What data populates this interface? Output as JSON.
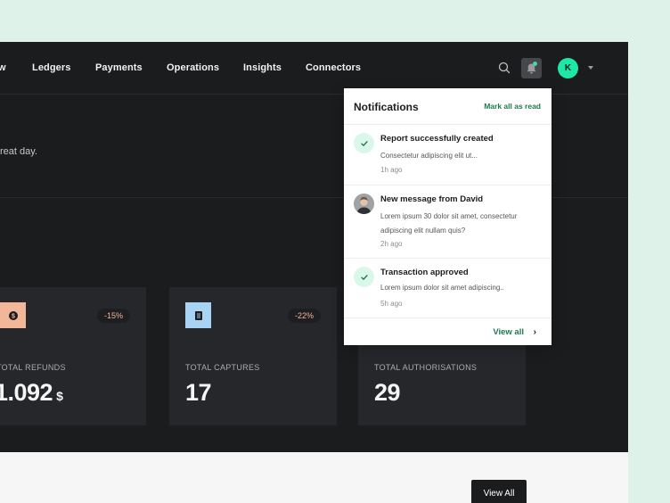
{
  "nav": {
    "items": [
      {
        "label": "w"
      },
      {
        "label": "Ledgers"
      },
      {
        "label": "Payments"
      },
      {
        "label": "Operations"
      },
      {
        "label": "Insights"
      },
      {
        "label": "Connectors"
      }
    ],
    "avatar_initial": "K",
    "icons": {
      "search": "search-icon",
      "bell": "bell-icon",
      "caret": "chevron-down-icon"
    }
  },
  "greeting": "reat day.",
  "cards": [
    {
      "icon": "dollar-icon",
      "icon_color": "#f2b699",
      "pct": "-15%",
      "label": "TOTAL REFUNDS",
      "value": "1.092",
      "unit": "$"
    },
    {
      "icon": "document-icon",
      "icon_color": "#a9d3f5",
      "pct": "-22%",
      "label": "TOTAL CAPTURES",
      "value": "17",
      "unit": ""
    },
    {
      "label": "TOTAL AUTHORISATIONS",
      "value": "29",
      "unit": ""
    }
  ],
  "notifications": {
    "title": "Notifications",
    "mark_all": "Mark all as read",
    "items": [
      {
        "icon": "check-icon",
        "title": "Report successfully created",
        "body": "Consectetur adipiscing elit ut...",
        "time": "1h ago"
      },
      {
        "icon": "avatar-photo",
        "title": "New message from David",
        "body": "Lorem ipsum 30 dolor sit amet, consectetur adipiscing elit nullam quis?",
        "time": "2h ago"
      },
      {
        "icon": "check-icon",
        "title": "Transaction approved",
        "body": "Lorem ipsum dolor sit amet adipiscing..",
        "time": "5h ago"
      }
    ],
    "view_all": "View all"
  },
  "bottom": {
    "view_all_button": "View All"
  },
  "colors": {
    "accent": "#1ee8a5",
    "link_green": "#1e7a4e",
    "dark_bg": "#1b1c1e",
    "card_bg": "#26272b"
  }
}
